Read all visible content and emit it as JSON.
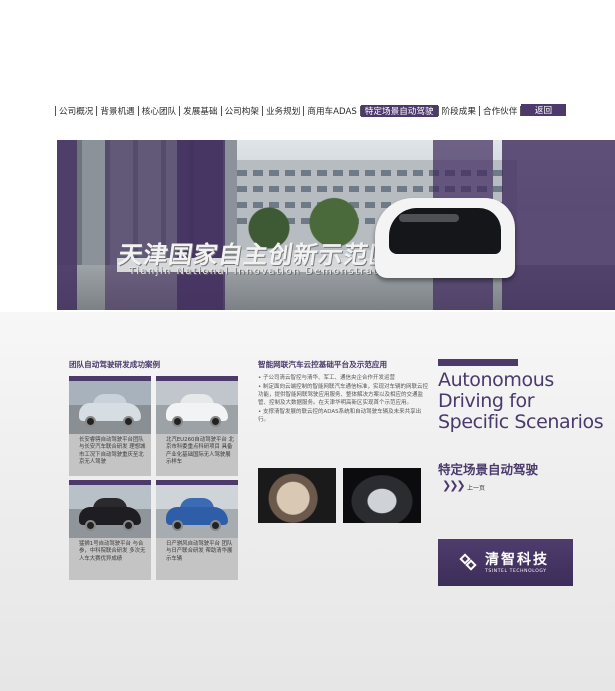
{
  "nav": {
    "items": [
      {
        "label": "公司概况",
        "active": false
      },
      {
        "label": "背景机遇",
        "active": false
      },
      {
        "label": "核心团队",
        "active": false
      },
      {
        "label": "发展基础",
        "active": false
      },
      {
        "label": "公司构架",
        "active": false
      },
      {
        "label": "业务规划",
        "active": false
      },
      {
        "label": "商用车ADAS",
        "active": false
      },
      {
        "label": "特定场景自动驾驶",
        "active": true
      },
      {
        "label": "阶段成果",
        "active": false
      },
      {
        "label": "合作伙伴",
        "active": false
      }
    ],
    "back_label": "返回"
  },
  "hero": {
    "sign_cn": "天津国家自主创新示范区",
    "sign_en": "Tianjin National Innovation Demonstration Zone"
  },
  "cases": {
    "title": "团队自动驾驶研发成功案例",
    "items": [
      {
        "caption": "长安睿骋自动驾驶平台团队与长安汽车联合研发 理想城市工况下自动驾驶重庆至北京无人驾驶"
      },
      {
        "caption": "北汽EU260自动驾驶平台 北京市科委重点科研项目 具备产业化基础国际无人驾驶展示样车"
      },
      {
        "caption": "猛狮1号自动驾驶平台 与合参，中科院联合研发 多次无人车大赛优异成绩"
      },
      {
        "caption": "日产骐风自动驾驶平台 团队与日产联合研发 帮助清华展示车辆"
      }
    ]
  },
  "platform": {
    "title": "智能网联汽车云控基础平台及示范应用",
    "bullets": [
      "子公司清云智控与清华、军工、通信央企合作开发运营",
      "制定面向云端控制的智能网联汽车通信标准，实现对车辆的网联云控功能，提供智能网联驾驶应用服务、整体解决方案以及相应的交通监管、控制及大数据服务。在天津华明高新区实现首个示范应用。",
      "支撑清智发展的联云控的ADAS系统和自动驾驶车辆及未来共享出行。"
    ]
  },
  "right": {
    "headline": "Autonomous Driving for Specific Scenarios",
    "subtitle_cn": "特定场景自动驾驶",
    "prev_icon": "triple-chevron-right",
    "prev_label": "上一页"
  },
  "logo": {
    "name_cn": "清智科技",
    "name_en": "TSINTEL TECHNOLOGY"
  },
  "colors": {
    "brand_purple": "#4d3a6b",
    "caption_gray": "#c4c4c4"
  }
}
